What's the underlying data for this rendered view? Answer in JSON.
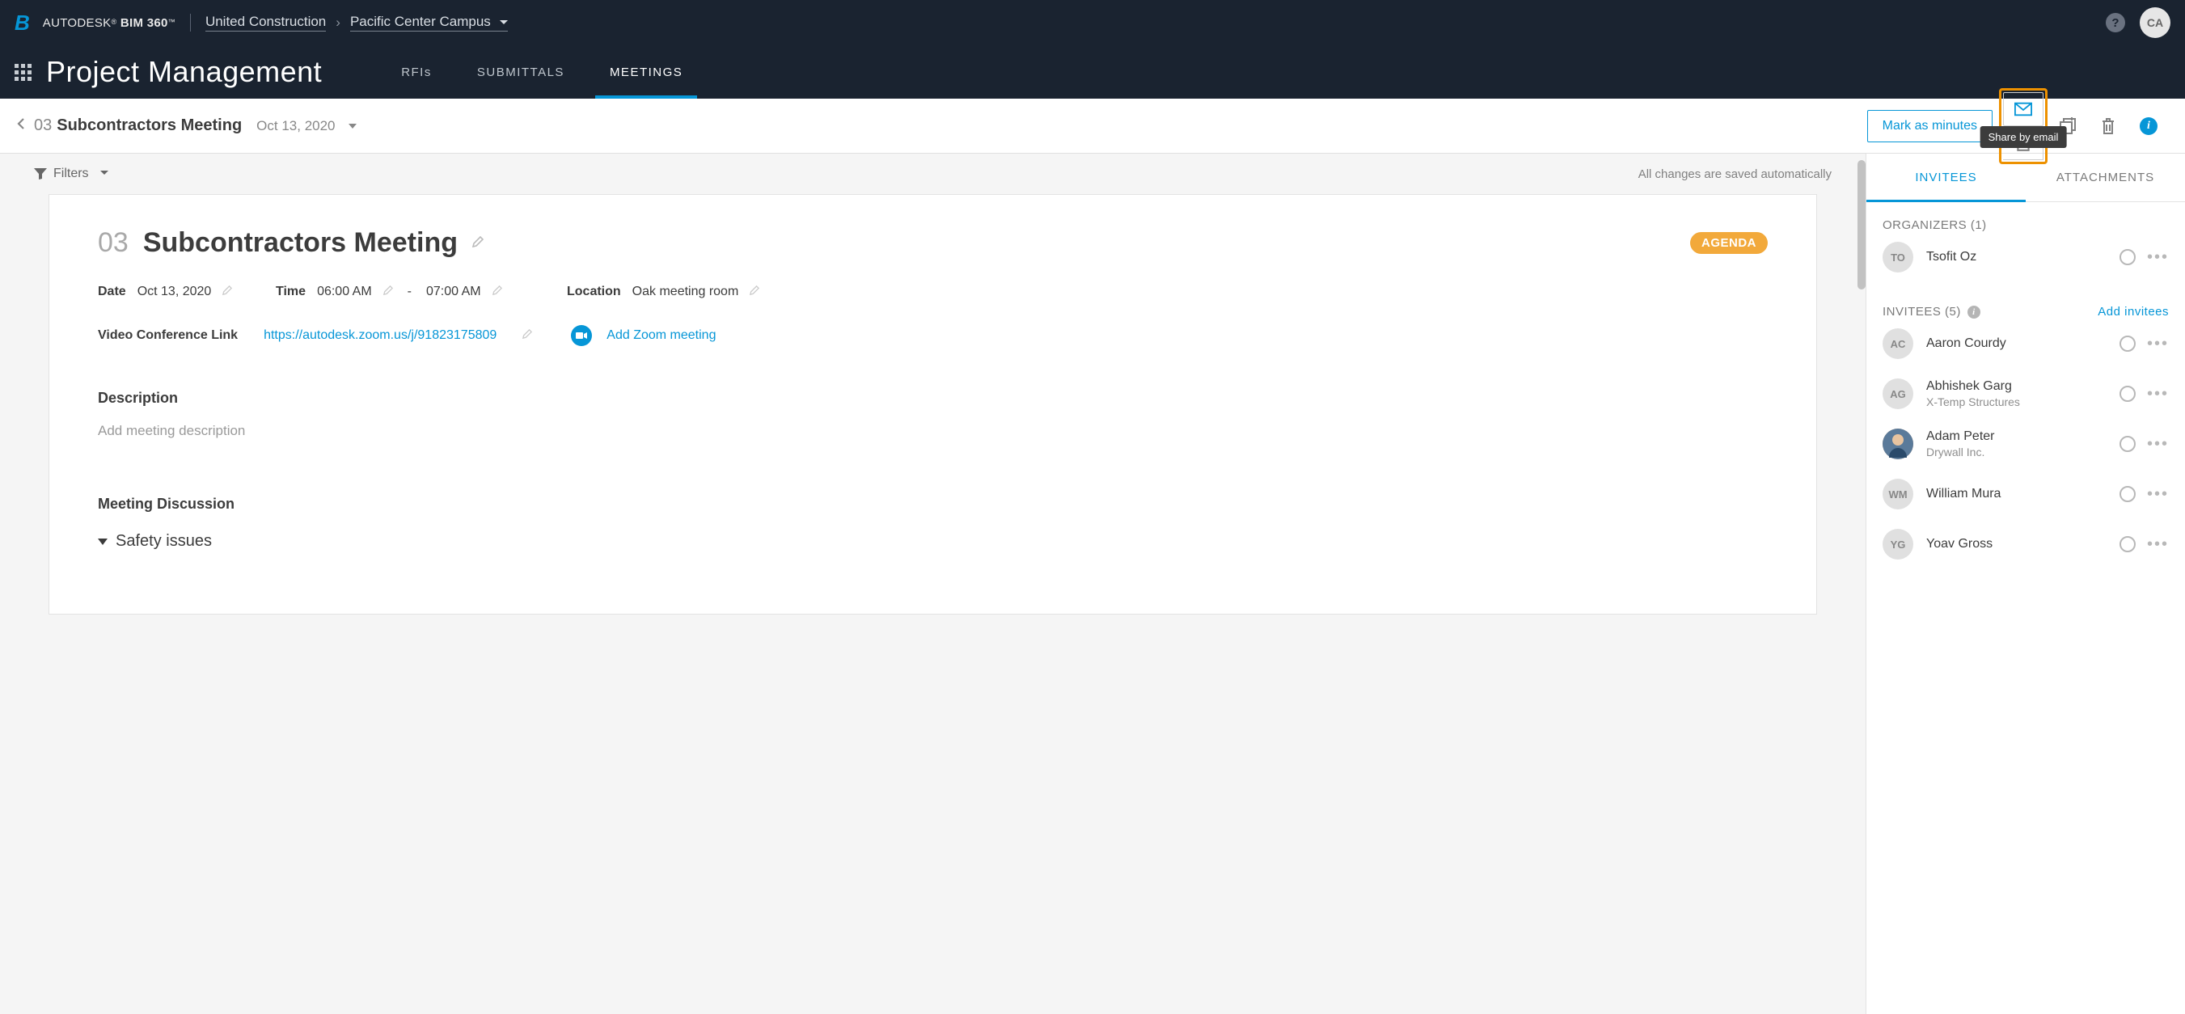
{
  "brand": {
    "autodesk": "AUTODESK",
    "product": "BIM 360",
    "tm": "™"
  },
  "breadcrumb": {
    "org": "United Construction",
    "project": "Pacific Center Campus"
  },
  "user_initials": "CA",
  "module": "Project Management",
  "nav": {
    "rfis": "RFIs",
    "submittals": "SUBMITTALS",
    "meetings": "MEETINGS"
  },
  "pagebar": {
    "number": "03",
    "title": "Subcontractors Meeting",
    "date": "Oct 13, 2020",
    "mark_btn": "Mark as minutes",
    "share_tooltip": "Share by email"
  },
  "filters_label": "Filters",
  "autosave": "All changes are saved automatically",
  "card": {
    "number": "03",
    "title": "Subcontractors Meeting",
    "badge": "AGENDA",
    "date_label": "Date",
    "date_val": "Oct 13, 2020",
    "time_label": "Time",
    "time_start": "06:00 AM",
    "time_end": "07:00 AM",
    "loc_label": "Location",
    "loc_val": "Oak meeting room",
    "link_label": "Video Conference Link",
    "link_url": "https://autodesk.zoom.us/j/91823175809",
    "add_zoom": "Add Zoom meeting",
    "desc_h": "Description",
    "desc_placeholder": "Add meeting description",
    "disc_h": "Meeting Discussion",
    "topic1": "Safety issues"
  },
  "side": {
    "tab_invitees": "INVITEES",
    "tab_attach": "ATTACHMENTS",
    "org_head": "ORGANIZERS (1)",
    "organizers": [
      {
        "initials": "TO",
        "name": "Tsofit Oz"
      }
    ],
    "inv_head": "INVITEES (5)",
    "add_link": "Add invitees",
    "invitees": [
      {
        "initials": "AC",
        "name": "Aaron Courdy",
        "company": ""
      },
      {
        "initials": "AG",
        "name": "Abhishek Garg",
        "company": "X-Temp Structures"
      },
      {
        "initials": "",
        "name": "Adam Peter",
        "company": "Drywall Inc.",
        "photo": true
      },
      {
        "initials": "WM",
        "name": "William Mura",
        "company": ""
      },
      {
        "initials": "YG",
        "name": "Yoav Gross",
        "company": ""
      }
    ]
  }
}
